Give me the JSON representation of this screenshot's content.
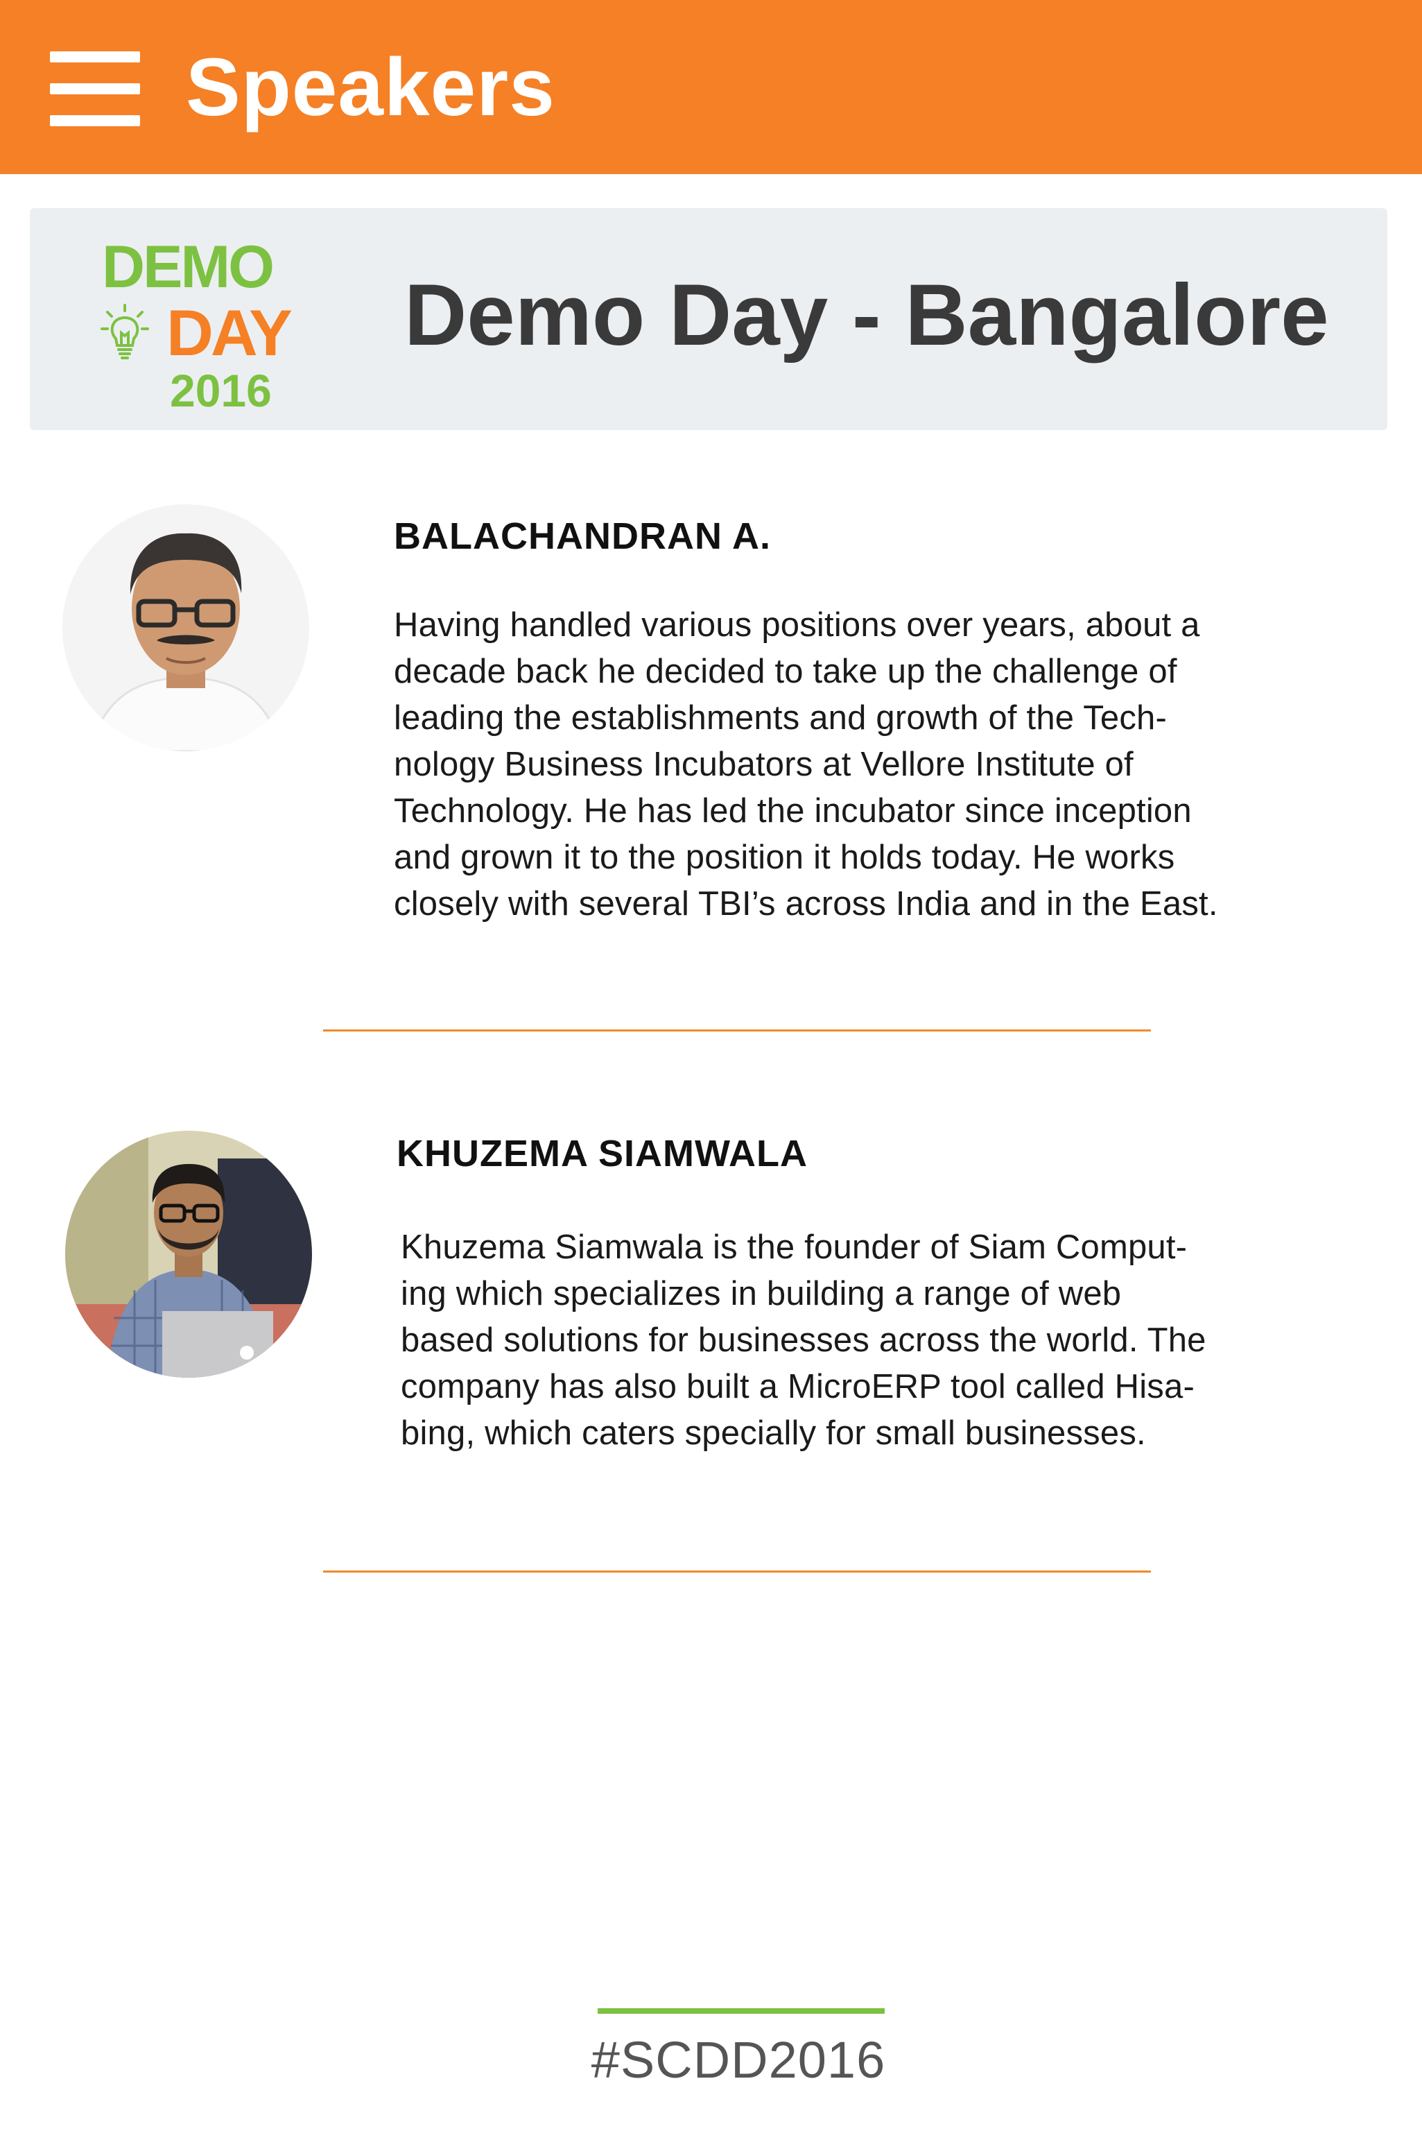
{
  "header": {
    "title": "Speakers",
    "menu_icon": "hamburger-menu-icon",
    "background_color": "#F58025"
  },
  "event": {
    "logo_text": {
      "line1": "DEMO",
      "line2": "DAY",
      "year": "2016"
    },
    "logo_icon": "lightbulb-icon",
    "title": "Demo Day - Bangalore"
  },
  "speakers": [
    {
      "name": "BALACHANDRAN A.",
      "bio_lines": [
        "Having handled various positions over years, about a",
        "decade back he decided to take up the challenge of",
        "leading the establishments and growth of the Tech-",
        "nology Business Incubators at Vellore Institute of",
        "Technology. He has led the incubator since inception",
        "and grown it to the position it holds today. He works",
        "closely with several TBI’s across India and in the East."
      ]
    },
    {
      "name": "KHUZEMA SIAMWALA",
      "bio_lines": [
        "Khuzema Siamwala is the founder of Siam Comput-",
        "ing which specializes in building a range of web",
        "based solutions for businesses across the world. The",
        "company has also built a MicroERP tool called Hisa-",
        "bing, which caters specially for small businesses."
      ]
    }
  ],
  "footer": {
    "hashtag": "#SCDD2016",
    "accent_color": "#7DC142"
  },
  "colors": {
    "accent_orange": "#F58025",
    "accent_green": "#7DC142",
    "banner_background": "#ECEFF1"
  }
}
